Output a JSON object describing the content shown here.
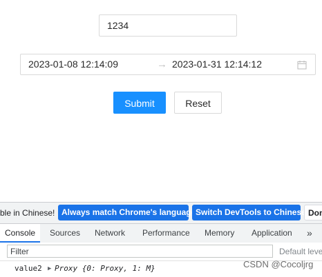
{
  "form": {
    "text_value": "1234",
    "range": {
      "start": "2023-01-08 12:14:09",
      "separator": "→",
      "end": "2023-01-31 12:14:12"
    },
    "submit_label": "Submit",
    "reset_label": "Reset"
  },
  "devtools": {
    "infobar": {
      "message": "ble in Chinese!",
      "match_language": "Always match Chrome's language",
      "switch_chinese": "Switch DevTools to Chinese",
      "dont_show": "Don"
    },
    "tabs": [
      "Console",
      "Sources",
      "Network",
      "Performance",
      "Memory",
      "Application"
    ],
    "more_tabs": "»",
    "close_icon": "×",
    "filter_placeholder": "Filter",
    "levels": "Default leve",
    "console": {
      "key": "value2",
      "value": "Proxy {0: Proxy, 1: M}"
    }
  },
  "watermark": "CSDN @Cocoljrg",
  "colors": {
    "primary": "#1890ff",
    "devtools_blue": "#1a73e8"
  }
}
